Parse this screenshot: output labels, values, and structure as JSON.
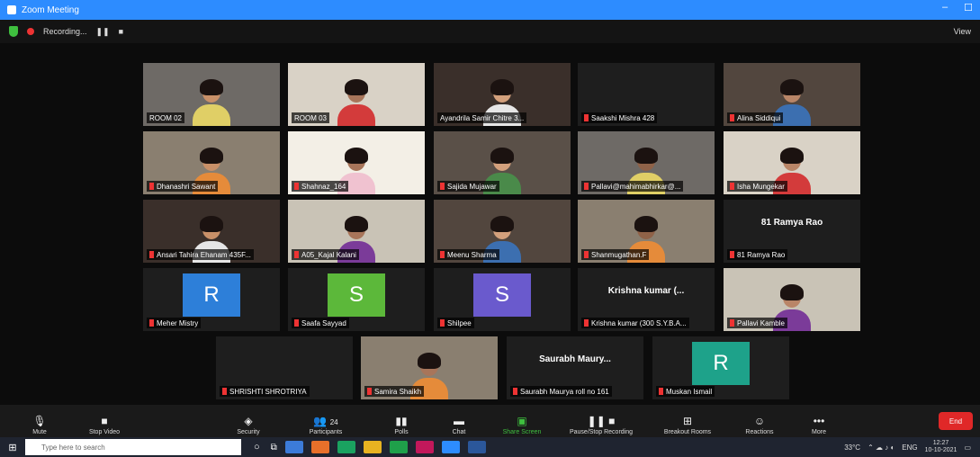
{
  "window": {
    "title": "Zoom Meeting",
    "minimize": "–",
    "maximize": "☐"
  },
  "topbar": {
    "recording_label": "Recording...",
    "pause": "❚❚",
    "stop": "■",
    "view_label": "View"
  },
  "participants": [
    {
      "name": "ROOM 02",
      "type": "video",
      "active": true
    },
    {
      "name": "ROOM 03",
      "type": "video"
    },
    {
      "name": "Ayandrila Samir Chitre 3...",
      "type": "video"
    },
    {
      "name": "Saakshi Mishra 428",
      "type": "blank"
    },
    {
      "name": "Alina Siddiqui",
      "type": "video"
    },
    {
      "name": "Dhanashri Sawant",
      "type": "video"
    },
    {
      "name": "Shahnaz_164",
      "type": "video"
    },
    {
      "name": "Sajida Mujawar",
      "type": "video"
    },
    {
      "name": "Pallavi@mahimabhirkar@...",
      "type": "video"
    },
    {
      "name": "Isha Mungekar",
      "type": "video"
    },
    {
      "name": "Ansari Tahira Ehanam 435F...",
      "type": "video"
    },
    {
      "name": "A05_Kajal Kalani",
      "type": "video"
    },
    {
      "name": "Meenu Sharma",
      "type": "video"
    },
    {
      "name": "Shanmugathan.F",
      "type": "video"
    },
    {
      "name": "81 Ramya Rao",
      "type": "name",
      "display": "81 Ramya Rao"
    },
    {
      "name": "Meher Mistry",
      "type": "avatar",
      "letter": "R",
      "color": "#2d7fd9"
    },
    {
      "name": "Saafa Sayyad",
      "type": "avatar",
      "letter": "S",
      "color": "#5cb83a"
    },
    {
      "name": "Shilpee",
      "type": "avatar",
      "letter": "S",
      "color": "#6a5acd"
    },
    {
      "name": "Krishna kumar (300 S.Y.B.A...",
      "type": "name",
      "display": "Krishna kumar (..."
    },
    {
      "name": "Pallavi Kamble",
      "type": "video"
    },
    {
      "name": "SHRISHTI SHROTRIYA",
      "type": "blank"
    },
    {
      "name": "Samira Shaikh",
      "type": "video"
    },
    {
      "name": "Saurabh Maurya roll no 161",
      "type": "name",
      "display": "Saurabh Maury..."
    },
    {
      "name": "Muskan Ismail",
      "type": "avatar",
      "letter": "R",
      "color": "#1ea28a"
    }
  ],
  "toolbar": {
    "mute": "Mute",
    "stop_video": "Stop Video",
    "security": "Security",
    "participants": "Participants",
    "participants_count": "24",
    "polls": "Polls",
    "chat": "Chat",
    "share_screen": "Share Screen",
    "pause_recording": "Pause/Stop Recording",
    "breakout": "Breakout Rooms",
    "reactions": "Reactions",
    "more": "More",
    "end": "End"
  },
  "taskbar": {
    "search_placeholder": "Type here to search",
    "weather": "33°C",
    "language": "ENG",
    "time": "12:27",
    "date": "10-10-2021"
  }
}
